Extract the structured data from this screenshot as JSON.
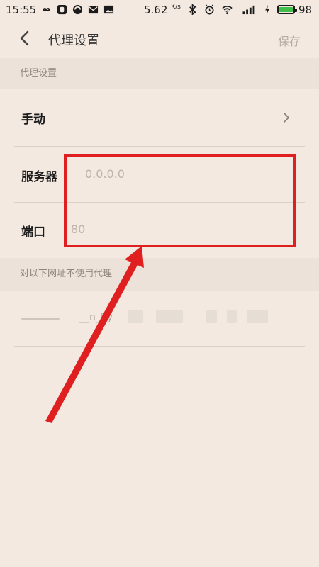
{
  "status_bar": {
    "time": "15:55",
    "net_speed": "5.62",
    "net_unit": "K/s",
    "battery_level": 98,
    "battery_text": "98"
  },
  "header": {
    "title": "代理设置",
    "save_label": "保存"
  },
  "proxy_section": {
    "heading": "代理设置",
    "mode_label": "手动",
    "server_label": "服务器",
    "server_placeholder": "0.0.0.0",
    "port_label": "端口",
    "port_placeholder": "80"
  },
  "bypass_section": {
    "heading": "对以下网址不使用代理",
    "value": "__n_hy"
  },
  "colors": {
    "background": "#f3e9e0",
    "annotation": "#e02020",
    "battery_fill": "#3fbf4a"
  }
}
